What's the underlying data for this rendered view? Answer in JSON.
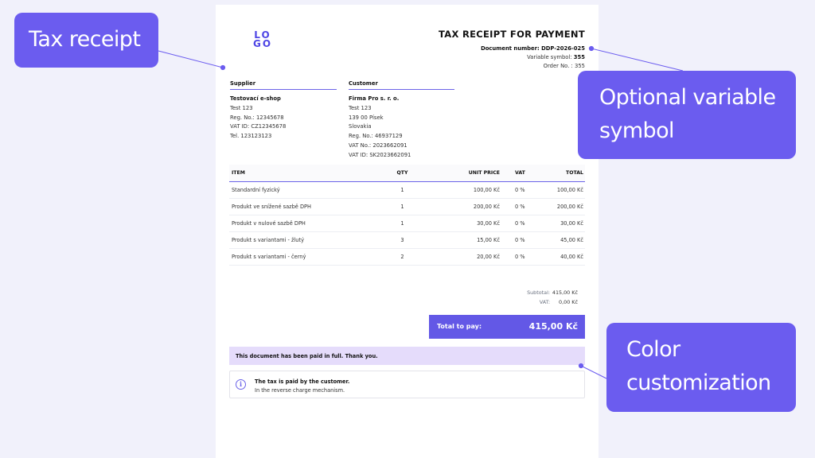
{
  "receipt": {
    "logo": "LOGO",
    "title": "TAX RECEIPT FOR PAYMENT",
    "document_number_label": "Document number:",
    "document_number": "DDP-2026-025",
    "variable_symbol_label": "Variable symbol:",
    "variable_symbol": "355",
    "order_no_label": "Order No. :",
    "order_no": "355"
  },
  "supplier": {
    "heading": "Supplier",
    "name": "Testovací e-shop",
    "lines": [
      "Test 123",
      "Reg. No.: 12345678",
      "VAT ID: CZ12345678",
      "Tel. 123123123"
    ]
  },
  "customer": {
    "heading": "Customer",
    "name": "Firma Pro s. r. o.",
    "lines": [
      "Test 123",
      "139 00 Písek",
      "Slovakia",
      "Reg. No.: 46937129",
      "VAT No.: 2023662091",
      "VAT ID: SK2023662091"
    ]
  },
  "table": {
    "headers": [
      "ITEM",
      "QTY",
      "UNIT PRICE",
      "VAT",
      "TOTAL"
    ],
    "rows": [
      [
        "Standardní fyzický",
        "1",
        "100,00 Kč",
        "0 %",
        "100,00 Kč"
      ],
      [
        "Produkt ve snížené sazbě DPH",
        "1",
        "200,00 Kč",
        "0 %",
        "200,00 Kč"
      ],
      [
        "Produkt v nulové sazbě DPH",
        "1",
        "30,00 Kč",
        "0 %",
        "30,00 Kč"
      ],
      [
        "Produkt s variantami - žlutý",
        "3",
        "15,00 Kč",
        "0 %",
        "45,00 Kč"
      ],
      [
        "Produkt s variantami - černý",
        "2",
        "20,00 Kč",
        "0 %",
        "40,00 Kč"
      ]
    ]
  },
  "summary": {
    "subtotal_label": "Subtotal:",
    "subtotal": "415,00 Kč",
    "vat_label": "VAT:",
    "vat": "0,00 Kč",
    "total_label": "Total to pay:",
    "total": "415,00 Kč"
  },
  "paid_notice": "This document has been paid in full. Thank you.",
  "note": {
    "title": "The tax is paid by the customer.",
    "desc": "In the reverse charge mechanism.",
    "icon": "info-icon"
  },
  "callouts": {
    "tax_receipt": "Tax receipt",
    "variable_symbol": [
      "Optional variable",
      "symbol"
    ],
    "color": [
      "Color",
      "customization"
    ]
  },
  "colors": {
    "accent": "#6358e6",
    "callout": "#6b5cef",
    "paid_bg": "#e5dcfb",
    "background": "#f1f1fb"
  }
}
